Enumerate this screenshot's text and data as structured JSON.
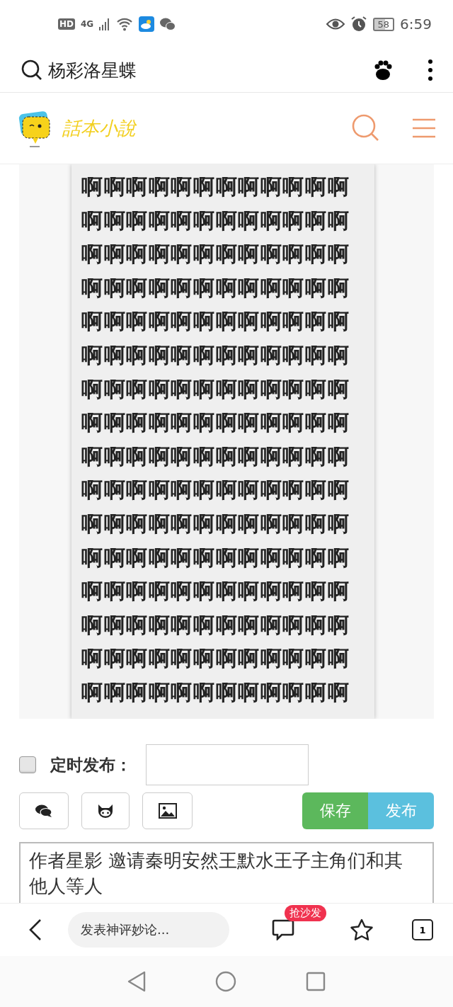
{
  "status_bar": {
    "hd": "HD",
    "network": "4G",
    "battery": "58",
    "time": "6:59"
  },
  "browser_bar": {
    "query": "杨彩洛星蝶"
  },
  "site": {
    "name": "話本小說"
  },
  "content_lines": [
    "啊啊啊啊啊啊啊啊啊啊啊啊",
    "啊啊啊啊啊啊啊啊啊啊啊啊",
    "啊啊啊啊啊啊啊啊啊啊啊啊",
    "啊啊啊啊啊啊啊啊啊啊啊啊",
    "啊啊啊啊啊啊啊啊啊啊啊啊",
    "啊啊啊啊啊啊啊啊啊啊啊啊",
    "啊啊啊啊啊啊啊啊啊啊啊啊",
    "啊啊啊啊啊啊啊啊啊啊啊啊",
    "啊啊啊啊啊啊啊啊啊啊啊啊",
    "啊啊啊啊啊啊啊啊啊啊啊啊",
    "啊啊啊啊啊啊啊啊啊啊啊啊",
    "啊啊啊啊啊啊啊啊啊啊啊啊",
    "啊啊啊啊啊啊啊啊啊啊啊啊",
    "啊啊啊啊啊啊啊啊啊啊啊啊",
    "啊啊啊啊啊啊啊啊啊啊啊啊",
    "啊啊啊啊啊啊啊啊啊啊啊啊"
  ],
  "schedule": {
    "label": "定时发布：",
    "checked": false
  },
  "actions": [
    {
      "label": "保存",
      "kind": "save"
    },
    {
      "label": "发布",
      "kind": "publish"
    }
  ],
  "editor": {
    "text": "作者星影 邀请秦明安然王默水王子主角们和其他人等人"
  },
  "bottom_bar": {
    "comment_placeholder": "发表神评妙论...",
    "badge": "抢沙发",
    "tab_count": "1"
  }
}
